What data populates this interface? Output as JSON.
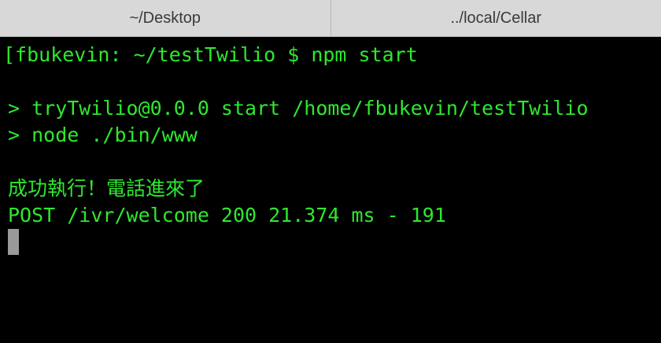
{
  "tabs": [
    {
      "label": "~/Desktop"
    },
    {
      "label": "../local/Cellar"
    }
  ],
  "terminal": {
    "lines": [
      "[fbukevin: ~/testTwilio $ npm start",
      "",
      "> tryTwilio@0.0.0 start /home/fbukevin/testTwilio",
      "> node ./bin/www",
      "",
      "成功執行！電話進來了",
      "POST /ivr/welcome 200 21.374 ms - 191"
    ]
  },
  "colors": {
    "terminal_text": "#2ee82e",
    "terminal_bg": "#000000",
    "tabbar_bg": "#d4d4d4",
    "cursor": "#9a9a9a"
  }
}
